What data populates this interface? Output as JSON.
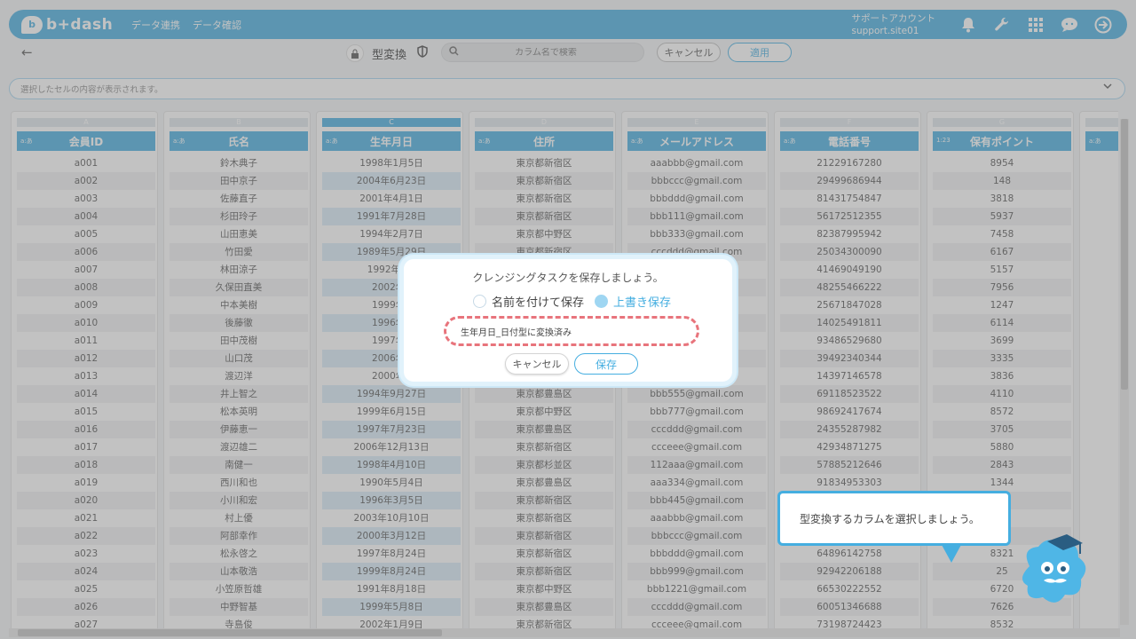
{
  "app": {
    "logo_mark": "b",
    "logo_text": "b+dash",
    "nav": [
      "データ連携",
      "データ確認"
    ],
    "account_name": "サポートアカウント",
    "account_id": "support.site01",
    "icons": [
      "bell-icon",
      "wrench-icon",
      "grid-icon",
      "chat-icon",
      "logout-icon"
    ]
  },
  "toolbar": {
    "back_glyph": "←",
    "title": "型変換",
    "search_placeholder": "カラム名で検索",
    "cancel_label": "キャンセル",
    "apply_label": "適用"
  },
  "cellbar": {
    "text": "選択したセルの内容が表示されます。"
  },
  "columns": [
    {
      "letter": "A",
      "type": "a:あ",
      "header": "会員ID",
      "cells": [
        "a001",
        "a002",
        "a003",
        "a004",
        "a005",
        "a006",
        "a007",
        "a008",
        "a009",
        "a010",
        "a011",
        "a012",
        "a013",
        "a014",
        "a015",
        "a016",
        "a017",
        "a018",
        "a019",
        "a020",
        "a021",
        "a022",
        "a023",
        "a024",
        "a025",
        "a026",
        "a027"
      ]
    },
    {
      "letter": "B",
      "type": "a:あ",
      "header": "氏名",
      "cells": [
        "鈴木典子",
        "田中京子",
        "佐藤直子",
        "杉田玲子",
        "山田恵美",
        "竹田愛",
        "林田涼子",
        "久保田直美",
        "中本美樹",
        "後藤徹",
        "田中茂樹",
        "山口茂",
        "渡辺洋",
        "井上智之",
        "松本英明",
        "伊藤恵一",
        "渡辺雄二",
        "南健一",
        "西川和也",
        "小川和宏",
        "村上優",
        "阿部幸作",
        "松永啓之",
        "山本敬浩",
        "小笠原哲雄",
        "中野智基",
        "寺島俊"
      ]
    },
    {
      "letter": "C",
      "type": "a:あ",
      "header": "生年月日",
      "selected": true,
      "cells": [
        "1998年1月5日",
        "2004年6月23日",
        "2001年4月1日",
        "1991年7月28日",
        "1994年2月7日",
        "1989年5月29日",
        "1992年4月",
        "2002年2",
        "1999年4",
        "1996年2",
        "1997年7",
        "2006年6",
        "2000年9",
        "1994年9月27日",
        "1999年6月15日",
        "1997年7月23日",
        "2006年12月13日",
        "1998年4月10日",
        "1990年5月4日",
        "1996年3月5日",
        "2003年10月10日",
        "2000年3月12日",
        "1997年8月24日",
        "1999年8月24日",
        "1991年8月18日",
        "1999年5月8日",
        "2002年1月9日"
      ]
    },
    {
      "letter": "D",
      "type": "a:あ",
      "header": "住所",
      "cells": [
        "東京都新宿区",
        "東京都新宿区",
        "東京都新宿区",
        "東京都新宿区",
        "東京都中野区",
        "東京都新宿区",
        "",
        "",
        "",
        "",
        "",
        "",
        "",
        "東京都豊島区",
        "東京都中野区",
        "東京都豊島区",
        "東京都新宿区",
        "東京都杉並区",
        "東京都豊島区",
        "東京都新宿区",
        "東京都新宿区",
        "東京都新宿区",
        "東京都新宿区",
        "東京都新宿区",
        "東京都中野区",
        "東京都豊島区",
        "東京都新宿区"
      ]
    },
    {
      "letter": "E",
      "type": "a:あ",
      "header": "メールアドレス",
      "cells": [
        "aaabbb@gmail.com",
        "bbbccc@gmail.com",
        "bbbddd@gmail.com",
        "bbb111@gmail.com",
        "bbb333@gmail.com",
        "cccddd@gmail.com",
        "",
        "",
        "",
        "",
        "",
        "",
        "",
        "bbb555@gmail.com",
        "bbb777@gmail.com",
        "cccddd@gmail.com",
        "ccceee@gmail.com",
        "112aaa@gmail.com",
        "aaa334@gmail.com",
        "bbb445@gmail.com",
        "aaabbb@gmail.com",
        "bbbccc@gmail.com",
        "bbbddd@gmail.com",
        "bbb999@gmail.com",
        "bbb1221@gmail.com",
        "cccddd@gmail.com",
        "ccceee@gmail.com"
      ]
    },
    {
      "letter": "F",
      "type": "a:あ",
      "header": "電話番号",
      "cells": [
        "21229167280",
        "29499686944",
        "81431754847",
        "56172512355",
        "82387995942",
        "25034300090",
        "41469049190",
        "48255466222",
        "25671847028",
        "14025491811",
        "93486529680",
        "39492340344",
        "14397146578",
        "69118523522",
        "98692417674",
        "24355287982",
        "42934871275",
        "57885212646",
        "91834953303",
        "",
        "",
        "",
        "64896142758",
        "92942206188",
        "66530222552",
        "60051346688",
        "73198724423"
      ]
    },
    {
      "letter": "G",
      "type": "1:23",
      "header": "保有ポイント",
      "cells": [
        "8954",
        "148",
        "3818",
        "5937",
        "7458",
        "6167",
        "5157",
        "7956",
        "1247",
        "6114",
        "3699",
        "3335",
        "3836",
        "4110",
        "8572",
        "3705",
        "5880",
        "2843",
        "1344",
        "",
        "",
        "",
        "8321",
        "25",
        "6720",
        "7626",
        "8532"
      ]
    },
    {
      "letter": "H",
      "type": "a:あ",
      "header": "",
      "cells": []
    }
  ],
  "modal": {
    "title": "クレンジングタスクを保存しましょう。",
    "option_new": "名前を付けて保存",
    "option_overwrite": "上書き保存",
    "name_value": "生年月日_日付型に変換済み",
    "cancel_label": "キャンセル",
    "save_label": "保存"
  },
  "tooltip": {
    "text": "型変換するカラムを選択しましょう。"
  },
  "colors": {
    "brand": "#45aee0",
    "dashed_border": "#e8747c"
  }
}
